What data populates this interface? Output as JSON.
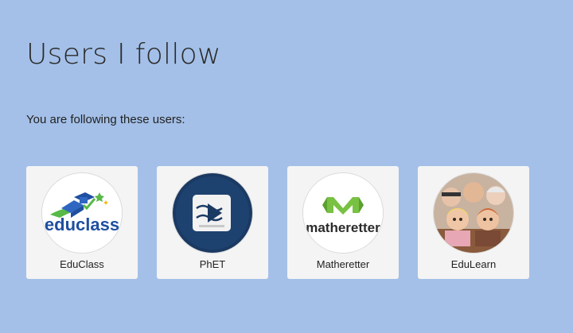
{
  "page": {
    "title": "Users I follow",
    "intro": "You are following these users:"
  },
  "users": [
    {
      "name": "EduClass",
      "logo_text": "educlass",
      "icon": "educlass-logo-icon",
      "brand_color": "#1f4fa0",
      "accent_color": "#58b947"
    },
    {
      "name": "PhET",
      "icon": "phet-play-icon",
      "brand_color": "#1b3a63"
    },
    {
      "name": "Matheretter",
      "logo_text": "matheretter",
      "icon": "matheretter-logo-icon",
      "brand_color": "#79c143"
    },
    {
      "name": "EduLearn",
      "icon": "puppet-group-photo",
      "brand_color": "#d9b89a"
    }
  ]
}
